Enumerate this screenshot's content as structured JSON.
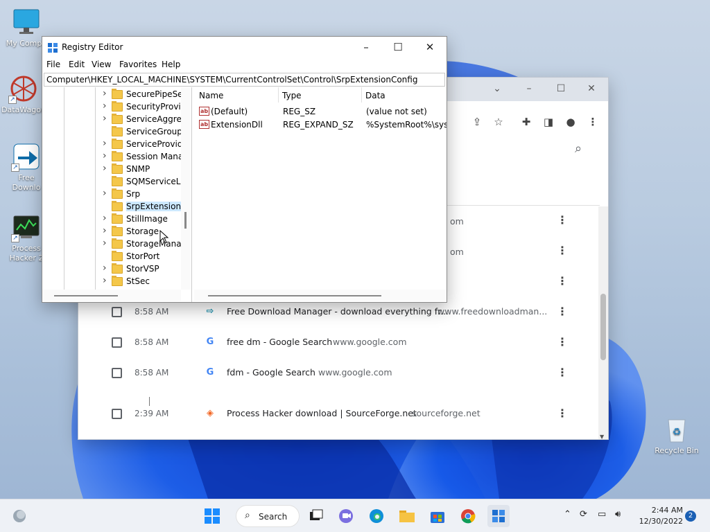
{
  "desktop": {
    "icons": [
      {
        "label": "My Compu"
      },
      {
        "label": "DataWagon"
      },
      {
        "label": "Free Downlo"
      },
      {
        "label": "Process Hacker 2"
      }
    ],
    "recycle_bin": "Recycle Bin"
  },
  "regedit": {
    "title": "Registry Editor",
    "menu": [
      "File",
      "Edit",
      "View",
      "Favorites",
      "Help"
    ],
    "address": "Computer\\HKEY_LOCAL_MACHINE\\SYSTEM\\CurrentControlSet\\Control\\SrpExtensionConfig",
    "tree": [
      {
        "label": "SecurePipeSer",
        "expandable": true
      },
      {
        "label": "SecurityProvid",
        "expandable": true
      },
      {
        "label": "ServiceAggreg",
        "expandable": true
      },
      {
        "label": "ServiceGroupC",
        "expandable": false
      },
      {
        "label": "ServiceProvide",
        "expandable": true
      },
      {
        "label": "Session Manag",
        "expandable": true
      },
      {
        "label": "SNMP",
        "expandable": true
      },
      {
        "label": "SQMServiceLis",
        "expandable": false
      },
      {
        "label": "Srp",
        "expandable": true
      },
      {
        "label": "SrpExtensionC",
        "expandable": false,
        "selected": true
      },
      {
        "label": "StillImage",
        "expandable": true
      },
      {
        "label": "Storage",
        "expandable": true
      },
      {
        "label": "StorageManag",
        "expandable": true
      },
      {
        "label": "StorPort",
        "expandable": false
      },
      {
        "label": "StorVSP",
        "expandable": true
      },
      {
        "label": "StSec",
        "expandable": true
      }
    ],
    "columns": {
      "name": "Name",
      "type": "Type",
      "data": "Data"
    },
    "values": [
      {
        "icon": "ab",
        "name": "(Default)",
        "type": "REG_SZ",
        "data": "(value not set)"
      },
      {
        "icon": "ab",
        "name": "ExtensionDll",
        "type": "REG_EXPAND_SZ",
        "data": "%SystemRoot%\\syste"
      }
    ]
  },
  "chrome": {
    "partial_domains": [
      "om",
      "om"
    ],
    "history": [
      {
        "time": "8:58 AM",
        "favicon": "fdm-icon",
        "title": "Free Download Manager - download everything fr...",
        "domain": "www.freedownloadman..."
      },
      {
        "time": "8:58 AM",
        "favicon": "google-icon",
        "title": "free dm - Google Search",
        "domain": "www.google.com"
      },
      {
        "time": "8:58 AM",
        "favicon": "google-icon",
        "title": "fdm - Google Search",
        "domain": "www.google.com"
      },
      {
        "time": "2:39 AM",
        "favicon": "sourceforge-icon",
        "title": "Process Hacker download | SourceForge.net",
        "domain": "sourceforge.net"
      }
    ]
  },
  "taskbar": {
    "search_label": "Search",
    "time": "2:44 AM",
    "date": "12/30/2022",
    "notification_count": "2"
  },
  "colors": {
    "accent": "#1a5fb4",
    "folder": "#f4c74a",
    "selection": "#cce8ff"
  }
}
